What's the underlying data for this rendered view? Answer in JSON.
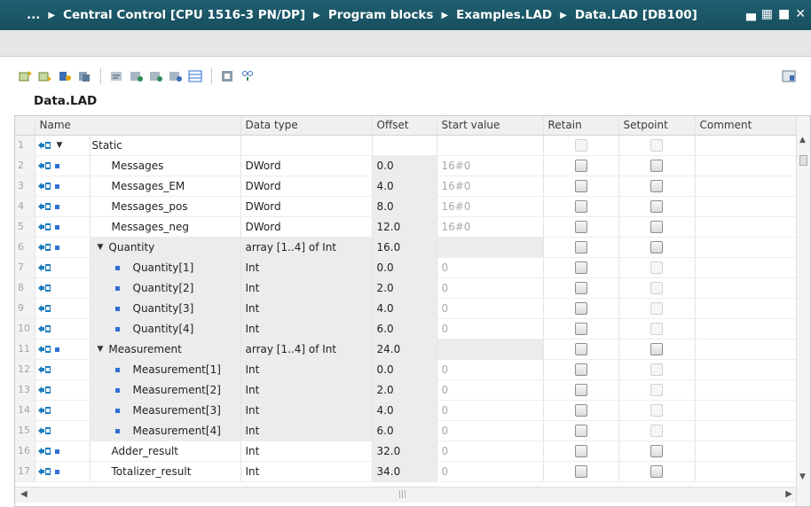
{
  "titlebar": {
    "prefix": "...",
    "crumbs": [
      "Central Control [CPU 1516-3 PN/DP]",
      "Program blocks",
      "Examples.LAD",
      "Data.LAD [DB100]"
    ]
  },
  "block_title": "Data.LAD",
  "columns": [
    "Name",
    "Data type",
    "Offset",
    "Start value",
    "Retain",
    "Setpoint",
    "Comment"
  ],
  "rows": [
    {
      "num": "1",
      "name": "Static",
      "type": "",
      "offset": "",
      "start": "",
      "level": 0,
      "expander": true,
      "square": false
    },
    {
      "num": "2",
      "name": "Messages",
      "type": "DWord",
      "offset": "0.0",
      "start": "16#0",
      "level": 1,
      "expander": false,
      "square": true
    },
    {
      "num": "3",
      "name": "Messages_EM",
      "type": "DWord",
      "offset": "4.0",
      "start": "16#0",
      "level": 1,
      "expander": false,
      "square": true
    },
    {
      "num": "4",
      "name": "Messages_pos",
      "type": "DWord",
      "offset": "8.0",
      "start": "16#0",
      "level": 1,
      "expander": false,
      "square": true
    },
    {
      "num": "5",
      "name": "Messages_neg",
      "type": "DWord",
      "offset": "12.0",
      "start": "16#0",
      "level": 1,
      "expander": false,
      "square": true
    },
    {
      "num": "6",
      "name": "Quantity",
      "type": "array [1..4] of Int",
      "offset": "16.0",
      "start": "",
      "level": 1,
      "expander": true,
      "square": true
    },
    {
      "num": "7",
      "name": "Quantity[1]",
      "type": "Int",
      "offset": "0.0",
      "start": "0",
      "level": 2,
      "expander": false,
      "square": true
    },
    {
      "num": "8",
      "name": "Quantity[2]",
      "type": "Int",
      "offset": "2.0",
      "start": "0",
      "level": 2,
      "expander": false,
      "square": true
    },
    {
      "num": "9",
      "name": "Quantity[3]",
      "type": "Int",
      "offset": "4.0",
      "start": "0",
      "level": 2,
      "expander": false,
      "square": true
    },
    {
      "num": "10",
      "name": "Quantity[4]",
      "type": "Int",
      "offset": "6.0",
      "start": "0",
      "level": 2,
      "expander": false,
      "square": true
    },
    {
      "num": "11",
      "name": "Measurement",
      "type": "array [1..4] of Int",
      "offset": "24.0",
      "start": "",
      "level": 1,
      "expander": true,
      "square": true
    },
    {
      "num": "12",
      "name": "Measurement[1]",
      "type": "Int",
      "offset": "0.0",
      "start": "0",
      "level": 2,
      "expander": false,
      "square": true
    },
    {
      "num": "13",
      "name": "Measurement[2]",
      "type": "Int",
      "offset": "2.0",
      "start": "0",
      "level": 2,
      "expander": false,
      "square": true
    },
    {
      "num": "14",
      "name": "Measurement[3]",
      "type": "Int",
      "offset": "4.0",
      "start": "0",
      "level": 2,
      "expander": false,
      "square": true
    },
    {
      "num": "15",
      "name": "Measurement[4]",
      "type": "Int",
      "offset": "6.0",
      "start": "0",
      "level": 2,
      "expander": false,
      "square": true
    },
    {
      "num": "16",
      "name": "Adder_result",
      "type": "Int",
      "offset": "32.0",
      "start": "0",
      "level": 1,
      "expander": false,
      "square": true
    },
    {
      "num": "17",
      "name": "Totalizer_result",
      "type": "Int",
      "offset": "34.0",
      "start": "0",
      "level": 1,
      "expander": false,
      "square": true
    }
  ],
  "colors": {
    "title_bg": "#1f5e70",
    "row_gray": "#ececec",
    "tag_icon": "#1a7bbf",
    "square": "#2f6fd4"
  }
}
